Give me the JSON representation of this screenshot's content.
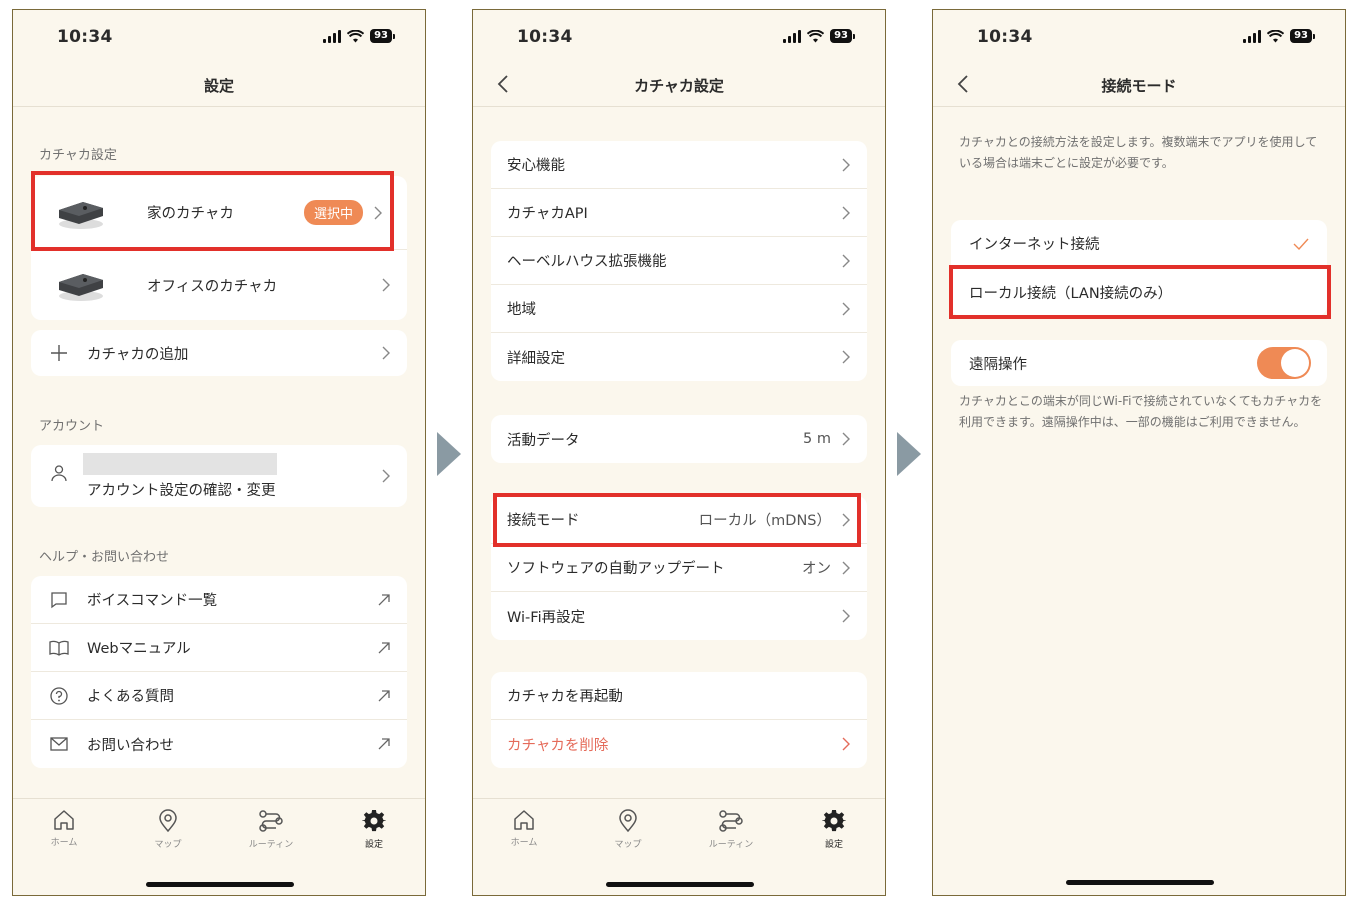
{
  "status": {
    "time": "10:34",
    "battery": "93"
  },
  "screen1": {
    "title": "設定",
    "section_device": "カチャカ設定",
    "devices": [
      {
        "name": "家のカチャカ",
        "badge": "選択中"
      },
      {
        "name": "オフィスのカチャカ"
      }
    ],
    "add_device": "カチャカの追加",
    "section_account": "アカウント",
    "account_link": "アカウント設定の確認・変更",
    "section_help": "ヘルプ・お問い合わせ",
    "help_items": [
      "ボイスコマンド一覧",
      "Webマニュアル",
      "よくある質問",
      "お問い合わせ"
    ]
  },
  "screen2": {
    "title": "カチャカ設定",
    "group1": [
      "安心機能",
      "カチャカAPI",
      "ヘーベルハウス拡張機能",
      "地域",
      "詳細設定"
    ],
    "activity": {
      "label": "活動データ",
      "value": "5 m"
    },
    "group3": [
      {
        "label": "接続モード",
        "value": "ローカル（mDNS）"
      },
      {
        "label": "ソフトウェアの自動アップデート",
        "value": "オン"
      },
      {
        "label": "Wi-Fi再設定",
        "value": ""
      }
    ],
    "restart": "カチャカを再起動",
    "delete": "カチャカを削除"
  },
  "screen3": {
    "title": "接続モード",
    "description": "カチャカとの接続方法を設定します。複数端末でアプリを使用している場合は端末ごとに設定が必要です。",
    "options": [
      "インターネット接続",
      "ローカル接続（LAN接続のみ）"
    ],
    "remote_label": "遠隔操作",
    "remote_on": true,
    "remote_description": "カチャカとこの端末が同じWi-Fiで接続されていなくてもカチャカを利用できます。遠隔操作中は、一部の機能はご利用できません。"
  },
  "tabs": [
    "ホーム",
    "マップ",
    "ルーティン",
    "設定"
  ],
  "colors": {
    "accent": "#ef8a55",
    "highlight": "#e2302a",
    "danger": "#e56b5a",
    "background": "#fbf7ed"
  }
}
